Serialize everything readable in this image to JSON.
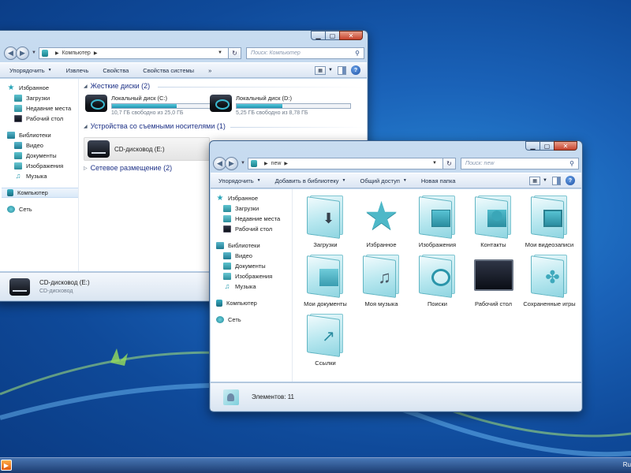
{
  "colors": {
    "desktop": "#1a62b8",
    "accent": "#2aa5b8",
    "group_header": "#1e3287",
    "bar_fill": "#1f92b0"
  },
  "back_window": {
    "address": {
      "segments": [
        "Компьютер"
      ]
    },
    "search_placeholder": "Поиск: Компьютер",
    "toolbar": {
      "items": [
        "Упорядочить",
        "Извлечь",
        "Свойства",
        "Свойства системы",
        "»"
      ]
    },
    "nav": {
      "favorites": "Избранное",
      "downloads": "Загрузки",
      "recent": "Недавние места",
      "desktop": "Рабочий стол",
      "libraries": "Библиотеки",
      "video": "Видео",
      "documents": "Документы",
      "pictures": "Изображения",
      "music": "Музыка",
      "computer": "Компьютер",
      "network": "Сеть"
    },
    "groups": {
      "hdd": "Жесткие диски (2)",
      "removable": "Устройства со съемными носителями (1)",
      "network": "Сетевое размещение (2)"
    },
    "drives": [
      {
        "name": "Локальный диск (C:)",
        "free": "10,7 ГБ свободно из 25,0 ГБ",
        "used_fraction": 0.57
      },
      {
        "name": "Локальный диск (D:)",
        "free": "5,25 ГБ свободно из 8,78 ГБ",
        "used_fraction": 0.4
      }
    ],
    "cd": {
      "name": "CD-дисковод (E:)"
    },
    "details": {
      "title": "CD-дисковод (E:)",
      "subtitle": "CD-дисковод"
    }
  },
  "front_window": {
    "address": {
      "segments": [
        "new"
      ]
    },
    "search_placeholder": "Поиск: new",
    "toolbar": {
      "items": [
        {
          "label": "Упорядочить",
          "dropdown": true
        },
        {
          "label": "Добавить в библиотеку",
          "dropdown": true
        },
        {
          "label": "Общий доступ",
          "dropdown": true
        },
        {
          "label": "Новая папка",
          "dropdown": false
        }
      ]
    },
    "nav": {
      "favorites": "Избранное",
      "downloads": "Загрузки",
      "recent": "Недавние места",
      "desktop": "Рабочий стол",
      "libraries": "Библиотеки",
      "video": "Видео",
      "documents": "Документы",
      "pictures": "Изображения",
      "music": "Музыка",
      "computer": "Компьютер",
      "network": "Сеть"
    },
    "items": [
      {
        "label": "Загрузки",
        "icon": "downloads-folder-icon"
      },
      {
        "label": "Избранное",
        "icon": "favorites-star-icon"
      },
      {
        "label": "Изображения",
        "icon": "pictures-folder-icon"
      },
      {
        "label": "Контакты",
        "icon": "contacts-folder-icon"
      },
      {
        "label": "Мои видеозаписи",
        "icon": "videos-folder-icon"
      },
      {
        "label": "Мои документы",
        "icon": "documents-folder-icon"
      },
      {
        "label": "Моя музыка",
        "icon": "music-folder-icon"
      },
      {
        "label": "Поиски",
        "icon": "searches-folder-icon"
      },
      {
        "label": "Рабочий стол",
        "icon": "desktop-icon"
      },
      {
        "label": "Сохраненные игры",
        "icon": "saved-games-folder-icon"
      },
      {
        "label": "Ссылки",
        "icon": "links-folder-icon"
      }
    ],
    "status": "Элементов: 11"
  },
  "taskbar": {
    "tray": "Ru"
  }
}
